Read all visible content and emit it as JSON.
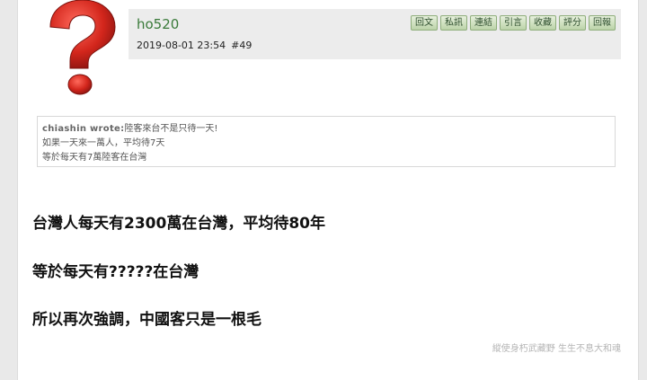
{
  "post": {
    "username": "ho520",
    "date": "2019-08-01 23:54",
    "post_number": "#49",
    "actions": [
      "回文",
      "私訊",
      "連結",
      "引言",
      "收藏",
      "評分",
      "回報"
    ],
    "quote": {
      "author": "chiashin wrote:",
      "first_line": "陸客來台不是只待一天!",
      "lines": [
        "如果一天來一萬人，平均待7天",
        "等於每天有7萬陸客在台灣"
      ]
    },
    "body": [
      "台灣人每天有2300萬在台灣，平均待80年",
      "等於每天有?????在台灣",
      "所以再次強調，中國客只是一根毛"
    ],
    "signature": "縱使身朽武藏野 生生不息大和魂"
  },
  "colors": {
    "username": "#3a7a3a",
    "button_bg": "#bcd3a9",
    "avatar_red": "#d3261c"
  },
  "icons": {
    "avatar": "question-mark-avatar-icon"
  }
}
